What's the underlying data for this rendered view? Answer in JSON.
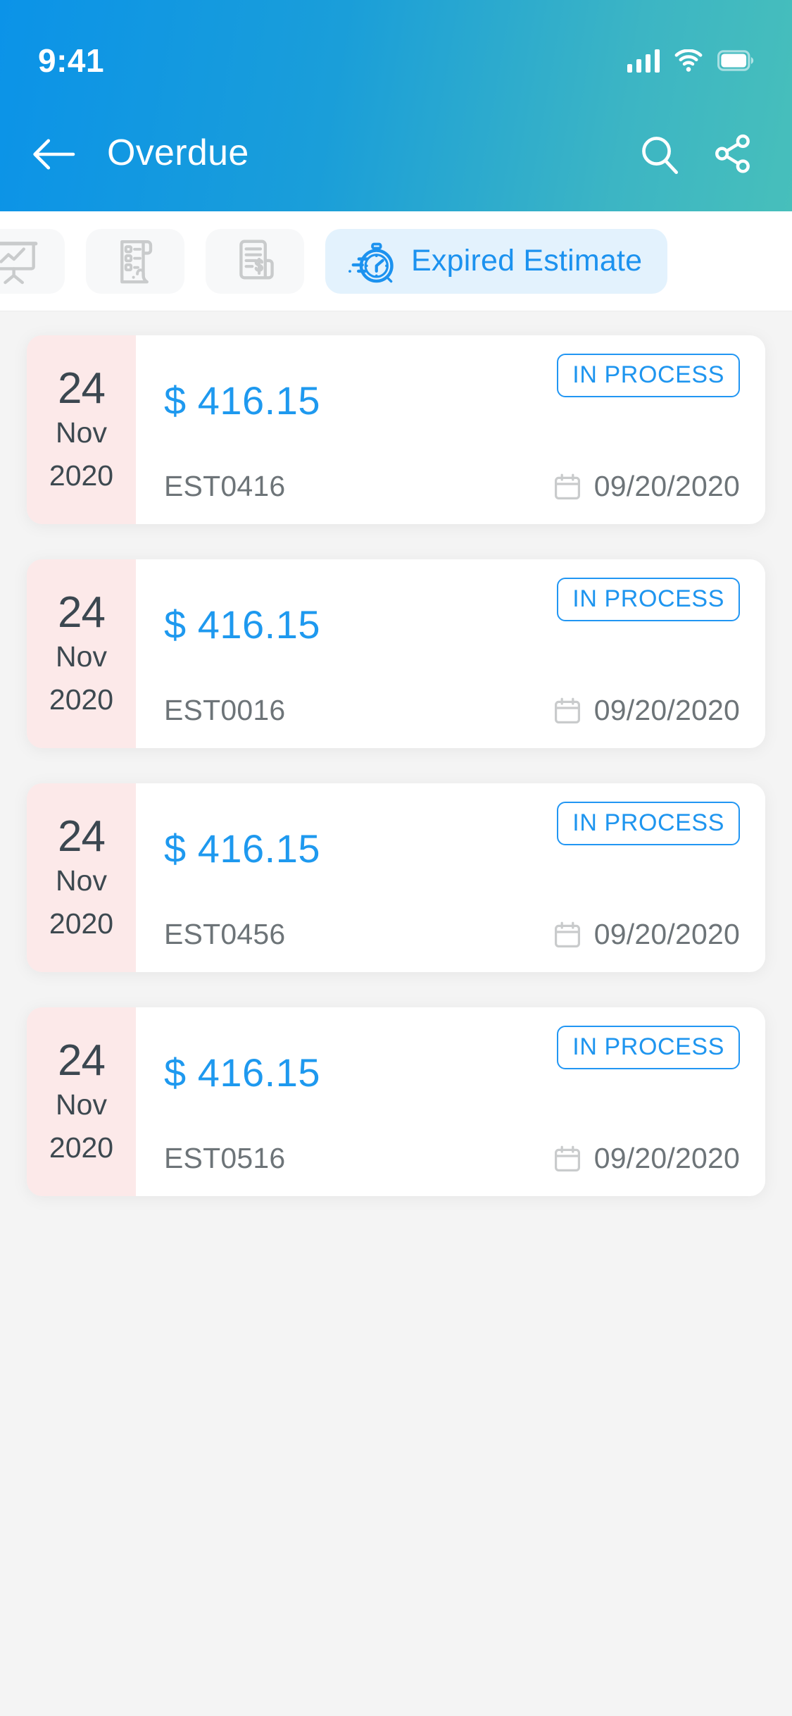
{
  "status_bar": {
    "time": "9:41",
    "icons": [
      "signal-icon",
      "wifi-icon",
      "battery-icon"
    ]
  },
  "header": {
    "title": "Overdue",
    "back_icon": "arrow-left-icon",
    "search_icon": "search-icon",
    "share_icon": "share-icon",
    "gradient_start": "#0b93e8",
    "gradient_end": "#47bfbb"
  },
  "filter_chips": [
    {
      "icon": "presentation-chart-icon",
      "label": "",
      "active": false
    },
    {
      "icon": "checklist-hand-icon",
      "label": "",
      "active": false
    },
    {
      "icon": "invoice-dollar-icon",
      "label": "",
      "active": false
    },
    {
      "icon": "stopwatch-icon",
      "label": "Expired Estimate",
      "active": true
    }
  ],
  "accent_color": "#1e99ef",
  "badge_color": "#2196f3",
  "date_block_color": "#fce9e9",
  "cards": [
    {
      "day": "24",
      "month": "Nov",
      "year": "2020",
      "amount": "$ 416.15",
      "estimate_id": "EST0416",
      "status": "IN PROCESS",
      "due_date": "09/20/2020",
      "calendar_icon": "calendar-icon"
    },
    {
      "day": "24",
      "month": "Nov",
      "year": "2020",
      "amount": "$ 416.15",
      "estimate_id": "EST0016",
      "status": "IN PROCESS",
      "due_date": "09/20/2020",
      "calendar_icon": "calendar-icon"
    },
    {
      "day": "24",
      "month": "Nov",
      "year": "2020",
      "amount": "$ 416.15",
      "estimate_id": "EST0456",
      "status": "IN PROCESS",
      "due_date": "09/20/2020",
      "calendar_icon": "calendar-icon"
    },
    {
      "day": "24",
      "month": "Nov",
      "year": "2020",
      "amount": "$ 416.15",
      "estimate_id": "EST0516",
      "status": "IN PROCESS",
      "due_date": "09/20/2020",
      "calendar_icon": "calendar-icon"
    }
  ]
}
